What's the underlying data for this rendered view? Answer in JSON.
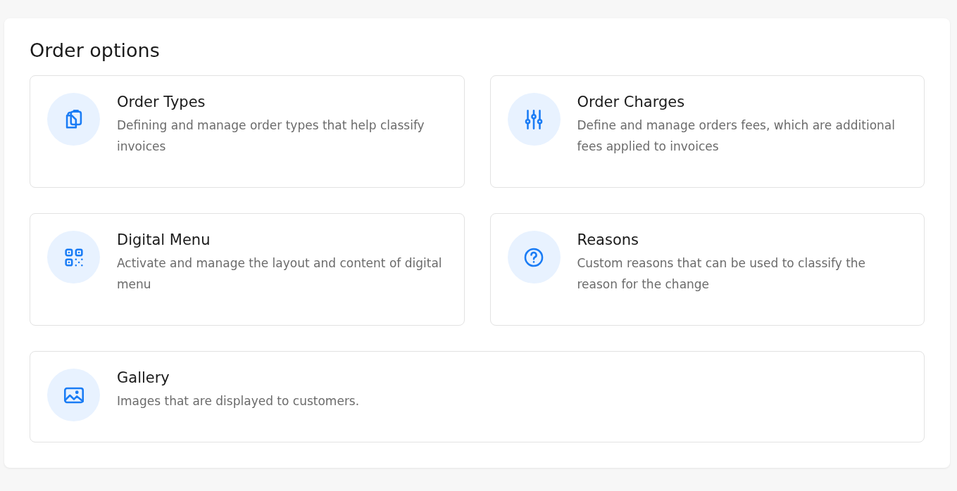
{
  "title": "Order options",
  "options": [
    {
      "title": "Order Types",
      "description": "Defining and manage order types that help classify invoices"
    },
    {
      "title": "Order Charges",
      "description": "Define and manage orders fees, which are additional fees applied to invoices"
    },
    {
      "title": "Digital Menu",
      "description": "Activate and manage the layout and content of digital menu"
    },
    {
      "title": "Reasons",
      "description": "Custom reasons that can be used to classify the reason for the change"
    },
    {
      "title": "Gallery",
      "description": "Images that are displayed to customers."
    }
  ]
}
